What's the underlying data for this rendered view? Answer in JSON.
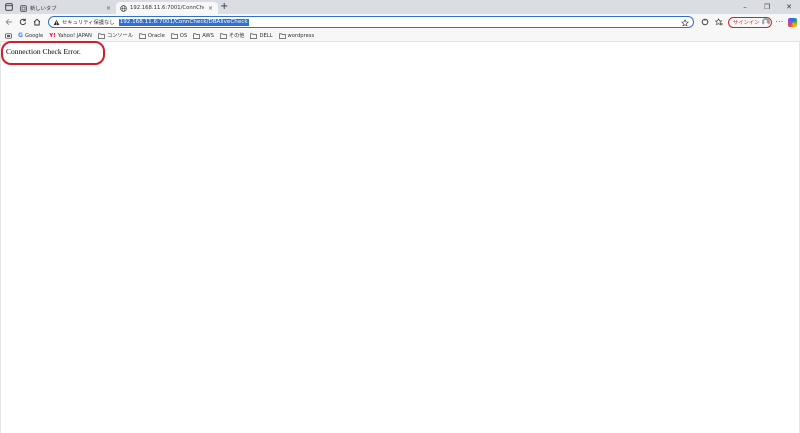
{
  "tabs": [
    {
      "title": "新しいタブ",
      "close": "×"
    },
    {
      "title": "192.168.11.6:7001/ConnCheck/DI",
      "close": "×"
    }
  ],
  "new_tab": "+",
  "window_controls": {
    "minimize": "–",
    "maximize": "❐",
    "close": "✕"
  },
  "address_bar": {
    "security_label": "セキュリティ保護なし",
    "url": "192.168.11.6:7001/ConnCheck/DBAliveCheck"
  },
  "toolbar": {
    "signin_label": "サインイン",
    "more": "···"
  },
  "bookmarks": [
    {
      "label": "",
      "icon": "app-icon"
    },
    {
      "label": "Google",
      "icon": "google-icon"
    },
    {
      "label": "Yahoo! JAPAN",
      "icon": "yahoo-icon"
    },
    {
      "label": "コンソール",
      "icon": "folder-icon"
    },
    {
      "label": "Oracle",
      "icon": "folder-icon"
    },
    {
      "label": "OS",
      "icon": "folder-icon"
    },
    {
      "label": "AWS",
      "icon": "folder-icon"
    },
    {
      "label": "その他",
      "icon": "folder-icon"
    },
    {
      "label": "DELL",
      "icon": "folder-icon"
    },
    {
      "label": "wordpress",
      "icon": "folder-icon"
    }
  ],
  "page": {
    "message": "Connection Check Error."
  },
  "colors": {
    "accent": "#2f6fd1",
    "highlight": "#d11f2a",
    "tabstrip": "#dadde3"
  }
}
